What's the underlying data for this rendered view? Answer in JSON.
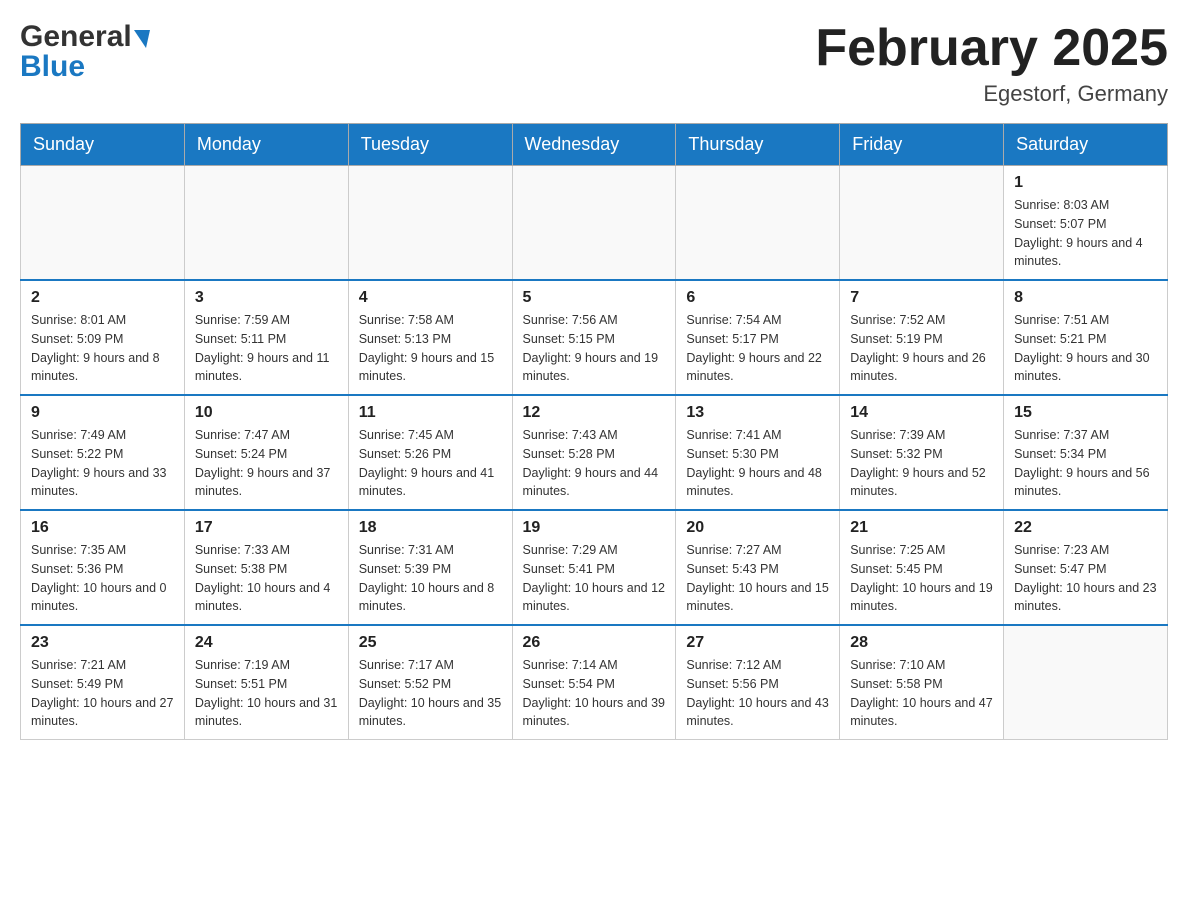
{
  "header": {
    "logo": {
      "general": "General",
      "blue": "Blue"
    },
    "title": "February 2025",
    "location": "Egestorf, Germany"
  },
  "weekdays": [
    "Sunday",
    "Monday",
    "Tuesday",
    "Wednesday",
    "Thursday",
    "Friday",
    "Saturday"
  ],
  "weeks": [
    [
      {
        "day": "",
        "info": ""
      },
      {
        "day": "",
        "info": ""
      },
      {
        "day": "",
        "info": ""
      },
      {
        "day": "",
        "info": ""
      },
      {
        "day": "",
        "info": ""
      },
      {
        "day": "",
        "info": ""
      },
      {
        "day": "1",
        "info": "Sunrise: 8:03 AM\nSunset: 5:07 PM\nDaylight: 9 hours and 4 minutes."
      }
    ],
    [
      {
        "day": "2",
        "info": "Sunrise: 8:01 AM\nSunset: 5:09 PM\nDaylight: 9 hours and 8 minutes."
      },
      {
        "day": "3",
        "info": "Sunrise: 7:59 AM\nSunset: 5:11 PM\nDaylight: 9 hours and 11 minutes."
      },
      {
        "day": "4",
        "info": "Sunrise: 7:58 AM\nSunset: 5:13 PM\nDaylight: 9 hours and 15 minutes."
      },
      {
        "day": "5",
        "info": "Sunrise: 7:56 AM\nSunset: 5:15 PM\nDaylight: 9 hours and 19 minutes."
      },
      {
        "day": "6",
        "info": "Sunrise: 7:54 AM\nSunset: 5:17 PM\nDaylight: 9 hours and 22 minutes."
      },
      {
        "day": "7",
        "info": "Sunrise: 7:52 AM\nSunset: 5:19 PM\nDaylight: 9 hours and 26 minutes."
      },
      {
        "day": "8",
        "info": "Sunrise: 7:51 AM\nSunset: 5:21 PM\nDaylight: 9 hours and 30 minutes."
      }
    ],
    [
      {
        "day": "9",
        "info": "Sunrise: 7:49 AM\nSunset: 5:22 PM\nDaylight: 9 hours and 33 minutes."
      },
      {
        "day": "10",
        "info": "Sunrise: 7:47 AM\nSunset: 5:24 PM\nDaylight: 9 hours and 37 minutes."
      },
      {
        "day": "11",
        "info": "Sunrise: 7:45 AM\nSunset: 5:26 PM\nDaylight: 9 hours and 41 minutes."
      },
      {
        "day": "12",
        "info": "Sunrise: 7:43 AM\nSunset: 5:28 PM\nDaylight: 9 hours and 44 minutes."
      },
      {
        "day": "13",
        "info": "Sunrise: 7:41 AM\nSunset: 5:30 PM\nDaylight: 9 hours and 48 minutes."
      },
      {
        "day": "14",
        "info": "Sunrise: 7:39 AM\nSunset: 5:32 PM\nDaylight: 9 hours and 52 minutes."
      },
      {
        "day": "15",
        "info": "Sunrise: 7:37 AM\nSunset: 5:34 PM\nDaylight: 9 hours and 56 minutes."
      }
    ],
    [
      {
        "day": "16",
        "info": "Sunrise: 7:35 AM\nSunset: 5:36 PM\nDaylight: 10 hours and 0 minutes."
      },
      {
        "day": "17",
        "info": "Sunrise: 7:33 AM\nSunset: 5:38 PM\nDaylight: 10 hours and 4 minutes."
      },
      {
        "day": "18",
        "info": "Sunrise: 7:31 AM\nSunset: 5:39 PM\nDaylight: 10 hours and 8 minutes."
      },
      {
        "day": "19",
        "info": "Sunrise: 7:29 AM\nSunset: 5:41 PM\nDaylight: 10 hours and 12 minutes."
      },
      {
        "day": "20",
        "info": "Sunrise: 7:27 AM\nSunset: 5:43 PM\nDaylight: 10 hours and 15 minutes."
      },
      {
        "day": "21",
        "info": "Sunrise: 7:25 AM\nSunset: 5:45 PM\nDaylight: 10 hours and 19 minutes."
      },
      {
        "day": "22",
        "info": "Sunrise: 7:23 AM\nSunset: 5:47 PM\nDaylight: 10 hours and 23 minutes."
      }
    ],
    [
      {
        "day": "23",
        "info": "Sunrise: 7:21 AM\nSunset: 5:49 PM\nDaylight: 10 hours and 27 minutes."
      },
      {
        "day": "24",
        "info": "Sunrise: 7:19 AM\nSunset: 5:51 PM\nDaylight: 10 hours and 31 minutes."
      },
      {
        "day": "25",
        "info": "Sunrise: 7:17 AM\nSunset: 5:52 PM\nDaylight: 10 hours and 35 minutes."
      },
      {
        "day": "26",
        "info": "Sunrise: 7:14 AM\nSunset: 5:54 PM\nDaylight: 10 hours and 39 minutes."
      },
      {
        "day": "27",
        "info": "Sunrise: 7:12 AM\nSunset: 5:56 PM\nDaylight: 10 hours and 43 minutes."
      },
      {
        "day": "28",
        "info": "Sunrise: 7:10 AM\nSunset: 5:58 PM\nDaylight: 10 hours and 47 minutes."
      },
      {
        "day": "",
        "info": ""
      }
    ]
  ]
}
